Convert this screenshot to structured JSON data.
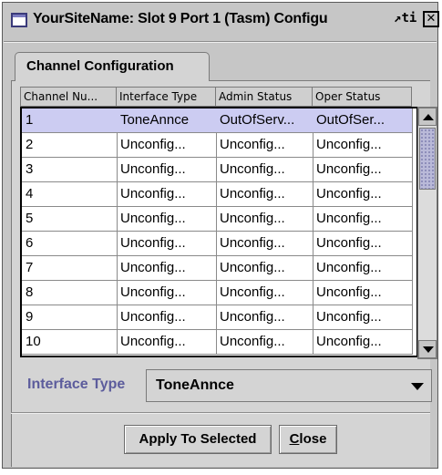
{
  "window": {
    "title": "YourSiteName: Slot 9 Port 1 (Tasm) Configu",
    "title_tail": "ti",
    "restore_glyph": "↗",
    "close_glyph": "✕"
  },
  "tabs": [
    {
      "label": "Channel Configuration",
      "active": true
    }
  ],
  "table": {
    "columns": [
      "Channel Nu...",
      "Interface Type",
      "Admin Status",
      "Oper Status"
    ],
    "rows": [
      [
        "1",
        "ToneAnnce",
        "OutOfServ...",
        "OutOfSer..."
      ],
      [
        "2",
        "Unconfig...",
        "Unconfig...",
        "Unconfig..."
      ],
      [
        "3",
        "Unconfig...",
        "Unconfig...",
        "Unconfig..."
      ],
      [
        "4",
        "Unconfig...",
        "Unconfig...",
        "Unconfig..."
      ],
      [
        "5",
        "Unconfig...",
        "Unconfig...",
        "Unconfig..."
      ],
      [
        "6",
        "Unconfig...",
        "Unconfig...",
        "Unconfig..."
      ],
      [
        "7",
        "Unconfig...",
        "Unconfig...",
        "Unconfig..."
      ],
      [
        "8",
        "Unconfig...",
        "Unconfig...",
        "Unconfig..."
      ],
      [
        "9",
        "Unconfig...",
        "Unconfig...",
        "Unconfig..."
      ],
      [
        "10",
        "Unconfig...",
        "Unconfig...",
        "Unconfig..."
      ]
    ],
    "selected_row_index": 0,
    "selection_color": "#ccccf2"
  },
  "interface_type": {
    "label": "Interface Type",
    "selected_value": "ToneAnnce"
  },
  "buttons": {
    "apply": "Apply To Selected",
    "close_mnemonic": "C",
    "close_rest": "lose"
  },
  "colors": {
    "window_bg": "#c6c6c6",
    "label_accent": "#5c5c9c"
  },
  "icons": {
    "window": "window-icon",
    "restore": "restore-icon",
    "close": "close-icon",
    "scroll_up": "scroll-up-icon",
    "scroll_down": "scroll-down-icon",
    "dropdown": "dropdown-arrow-icon"
  }
}
